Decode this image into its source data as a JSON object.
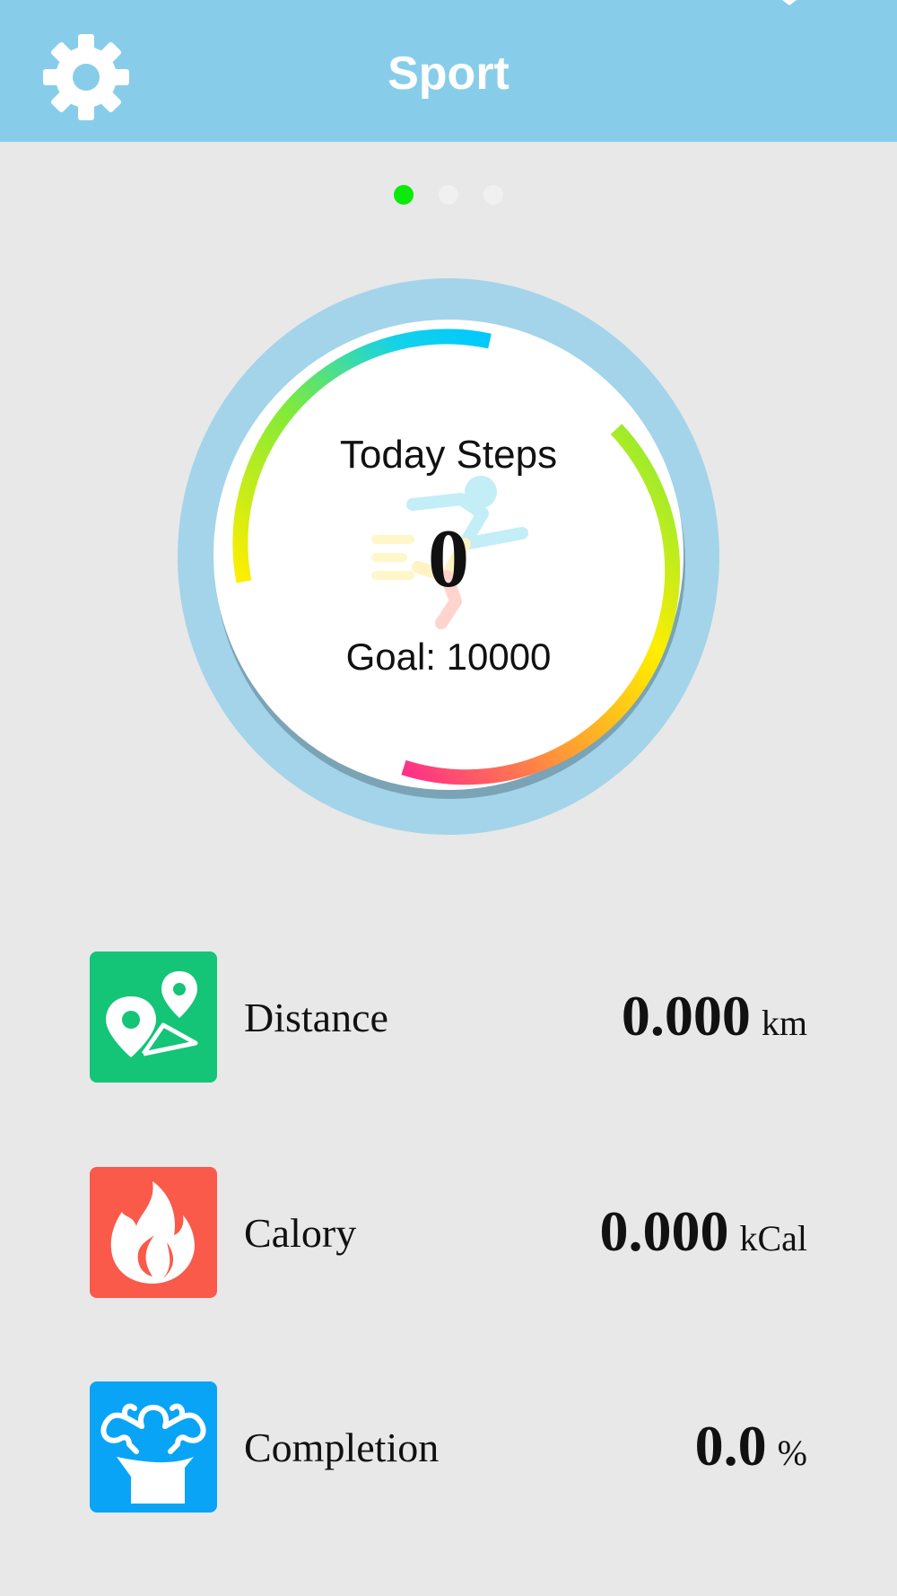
{
  "header": {
    "title": "Sport",
    "settings_icon": "gear-icon",
    "background_color": "#87cde9"
  },
  "pager": {
    "page_count": 3,
    "active_index": 0,
    "active_color": "#0bea0b"
  },
  "ring": {
    "label": "Today Steps",
    "steps": "0",
    "goal_text": "Goal: 10000",
    "center_icon": "running-person-icon",
    "gradient_colors": [
      "#ff2d8a",
      "#ffb020",
      "#ffee00",
      "#7fea3a",
      "#14d2e8",
      "#00c8ff"
    ]
  },
  "stats": [
    {
      "label": "Distance",
      "value": "0.000",
      "unit": "km",
      "icon": "map-pin-route-icon",
      "color": "#14c477"
    },
    {
      "label": "Calory",
      "value": "0.000",
      "unit": "kCal",
      "icon": "flame-icon",
      "color": "#fa5a4a"
    },
    {
      "label": "Completion",
      "value": "0.0",
      "unit": "%",
      "icon": "muscle-person-icon",
      "color": "#0aa4f6"
    }
  ]
}
